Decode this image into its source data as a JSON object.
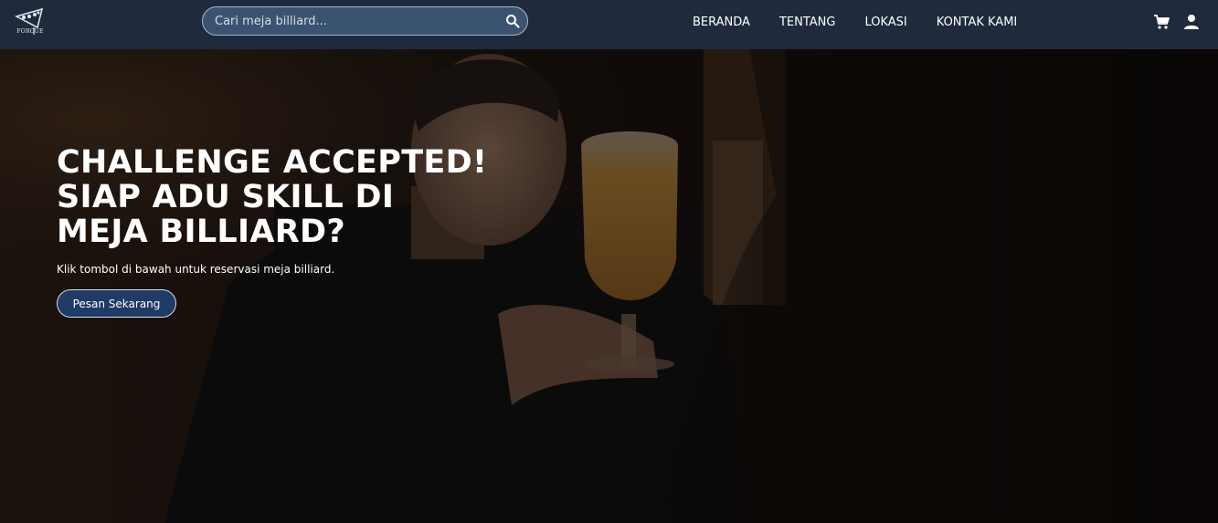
{
  "brand": {
    "logo_text": "FORCUE",
    "logo_icon": "billiard-logo-icon"
  },
  "search": {
    "placeholder": "Cari meja billiard...",
    "value": "",
    "icon": "search-icon"
  },
  "nav": {
    "links": [
      "BERANDA",
      "TENTANG",
      "LOKASI",
      "KONTAK KAMI"
    ],
    "icons": [
      "cart-icon",
      "user-icon"
    ]
  },
  "hero": {
    "title": "CHALLENGE ACCEPTED! SIAP ADU SKILL DI MEJA BILLIARD?",
    "subtitle": "Klik tombol di bawah untuk reservasi meja billiard.",
    "cta_label": "Pesan Sekarang"
  },
  "colors": {
    "navbar": "#1f2a3d",
    "search_bg": "#3a5370",
    "cta_bg": "#1f3b66",
    "text": "#ffffff"
  }
}
